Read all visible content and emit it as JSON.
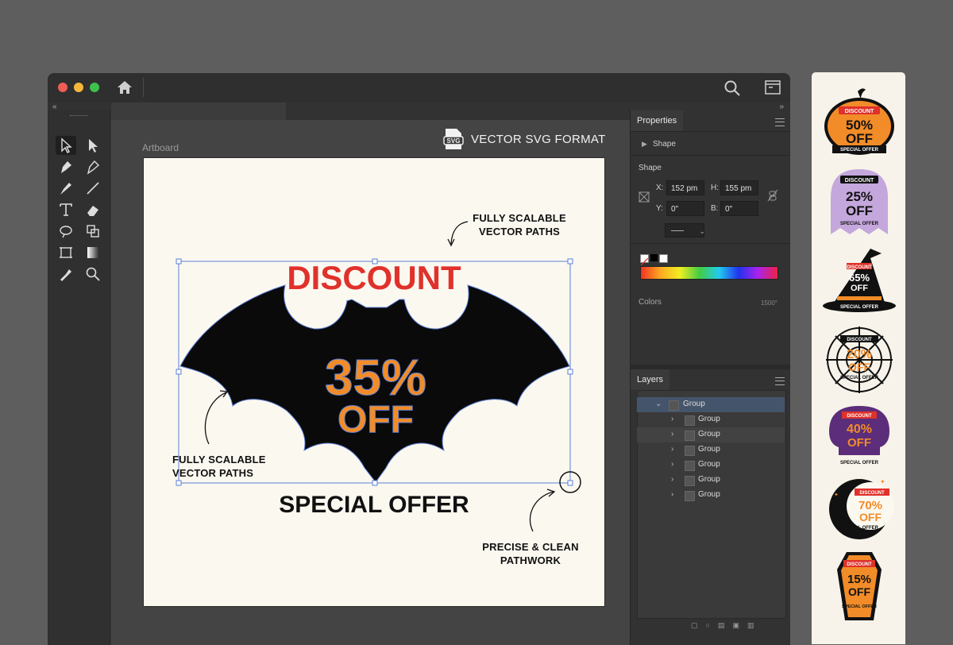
{
  "window": {
    "traffic_lights": [
      "#ee5d55",
      "#f5b73a",
      "#3fbf4c"
    ],
    "icons": [
      "home-icon",
      "search-icon",
      "panel-toggle-icon"
    ]
  },
  "canvas": {
    "artboard_label": "Artboard",
    "format_badge": "SVG",
    "format_label": "VECTOR SVG FORMAT"
  },
  "artwork": {
    "headline": "DISCOUNT",
    "percent": "35%",
    "off": "OFF",
    "footer": "SPECIAL OFFER",
    "headline_color": "#e0312b",
    "percent_color": "#f28c28",
    "annotation_top": [
      "FULLY SCALABLE",
      "VECTOR PATHS"
    ],
    "annotation_left": [
      "FULLY SCALABLE",
      "VECTOR PATHS"
    ],
    "annotation_bottom": [
      "PRECISE & CLEAN",
      "PATHWORK"
    ]
  },
  "properties": {
    "tab": "Properties",
    "section_shape": "Shape",
    "shape_heading": "Shape",
    "x_label": "X:",
    "x_value": "152 pm",
    "h_label": "H:",
    "h_value": "155 pm",
    "y_label": "Y:",
    "y_value": "0\"",
    "b_label": "B:",
    "b_value": "0\"",
    "colors_label": "Colors",
    "colors_value": "1500°"
  },
  "layers": {
    "tab": "Layers",
    "parent": "Group",
    "children": [
      "Group",
      "Group",
      "Group",
      "Group",
      "Group",
      "Group"
    ]
  },
  "sidebar_badges": [
    {
      "tag": "DISCOUNT",
      "value": "50%",
      "off": "OFF",
      "sub": "SPECIAL OFFER",
      "shape": "pumpkin"
    },
    {
      "tag": "DISCOUNT",
      "value": "25%",
      "off": "OFF",
      "sub": "SPECIAL OFFER",
      "shape": "ghost"
    },
    {
      "tag": "DISCOUNT",
      "value": "65%",
      "off": "OFF",
      "sub": "SPECIAL OFFER",
      "shape": "witch-hat"
    },
    {
      "tag": "DISCOUNT",
      "value": "20%",
      "off": "OFF",
      "sub": "SPECIAL OFFER",
      "shape": "spider-web"
    },
    {
      "tag": "DISCOUNT",
      "value": "40%",
      "off": "OFF",
      "sub": "SPECIAL OFFER",
      "shape": "skull"
    },
    {
      "tag": "DISCOUNT",
      "value": "70%",
      "off": "OFF",
      "sub": "SPECIAL OFFER",
      "shape": "moon"
    },
    {
      "tag": "DISCOUNT",
      "value": "15%",
      "off": "OFF",
      "sub": "SPECIAL OFFER",
      "shape": "coffin"
    }
  ]
}
